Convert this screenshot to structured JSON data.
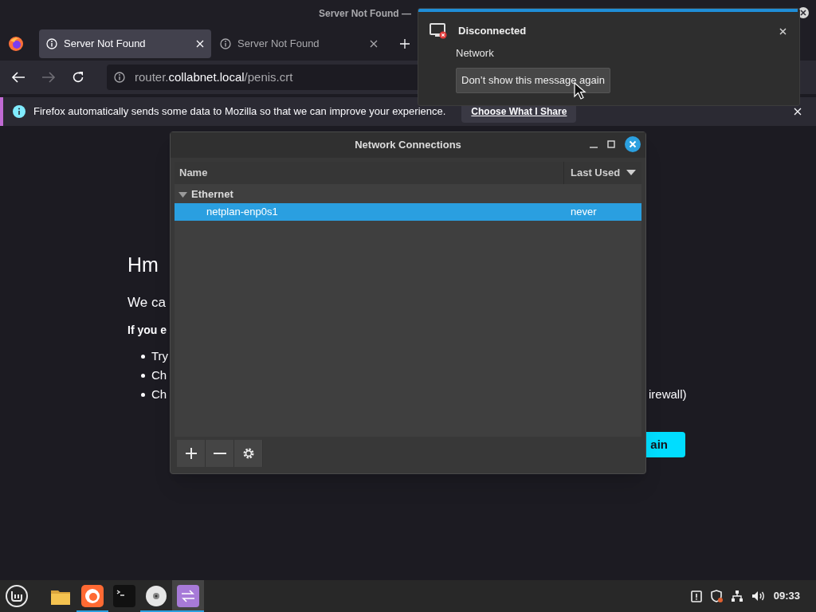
{
  "browser": {
    "title": "Server Not Found —",
    "tabs": [
      {
        "label": "Server Not Found",
        "selected": true
      },
      {
        "label": "Server Not Found",
        "selected": false
      }
    ],
    "url": {
      "subdomain": "router.",
      "domain": "collabnet.local",
      "path": "/penis.crt"
    },
    "infobar": {
      "message": "Firefox automatically sends some data to Mozilla so that we can improve your experience.",
      "button": "Choose What I Share"
    },
    "page": {
      "heading": "Hm",
      "lead": "We ca",
      "bold_line": "If you e",
      "bullets": [
        "Try",
        "Ch",
        "Ch"
      ],
      "bullet_tail": "irewall)",
      "button": "ain"
    }
  },
  "notification": {
    "level": 1,
    "title": "Disconnected",
    "body": "Network",
    "button": "Don’t show this message again"
  },
  "dialog": {
    "title": "Network Connections",
    "columns": [
      "Name",
      "Last Used"
    ],
    "groups": [
      {
        "label": "Ethernet",
        "expanded": true,
        "children": [
          {
            "name": "netplan-enp0s1",
            "last_used": "never",
            "selected": true
          }
        ]
      }
    ]
  },
  "taskbar": {
    "apps": [
      {
        "kind": "files",
        "running": false,
        "selected": false
      },
      {
        "kind": "firefox",
        "running": true,
        "selected": false
      },
      {
        "kind": "terminal",
        "running": false,
        "selected": false
      },
      {
        "kind": "disc",
        "running": true,
        "selected": false
      },
      {
        "kind": "network",
        "running": true,
        "selected": true
      }
    ],
    "clock": "09:33"
  }
}
